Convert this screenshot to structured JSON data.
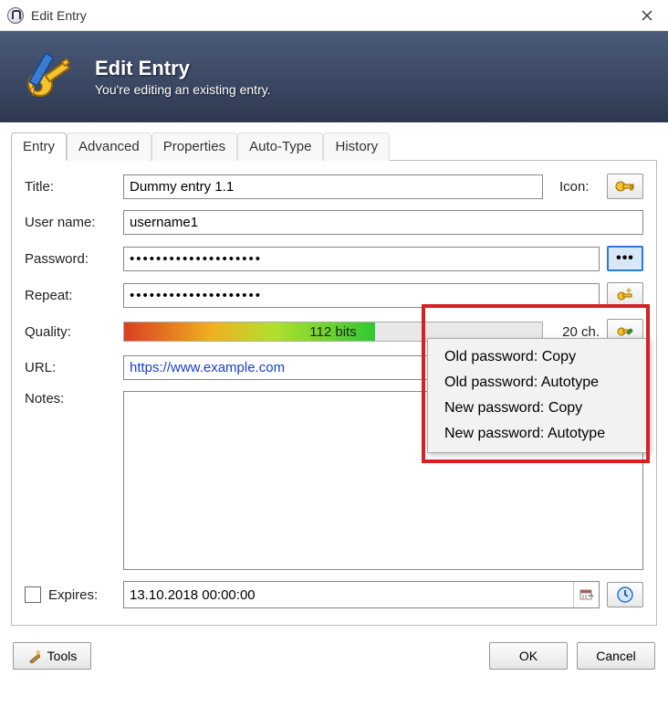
{
  "window": {
    "title": "Edit Entry"
  },
  "banner": {
    "heading": "Edit Entry",
    "subheading": "You're editing an existing entry."
  },
  "tabs": [
    "Entry",
    "Advanced",
    "Properties",
    "Auto-Type",
    "History"
  ],
  "labels": {
    "title": "Title:",
    "username": "User name:",
    "password": "Password:",
    "repeat": "Repeat:",
    "quality": "Quality:",
    "url": "URL:",
    "notes": "Notes:",
    "expires": "Expires:",
    "icon": "Icon:"
  },
  "fields": {
    "title": "Dummy entry 1.1",
    "username": "username1",
    "password": "••••••••••••••••••••",
    "repeat": "••••••••••••••••••••",
    "url": "https://www.example.com",
    "notes": "",
    "expires": "13.10.2018 00:00:00"
  },
  "quality": {
    "bits": "112 bits",
    "chars": "20 ch."
  },
  "menu": {
    "items": [
      "Old password: Copy",
      "Old password: Autotype",
      "New password: Copy",
      "New password: Autotype"
    ]
  },
  "buttons": {
    "tools": "Tools",
    "ok": "OK",
    "cancel": "Cancel"
  }
}
